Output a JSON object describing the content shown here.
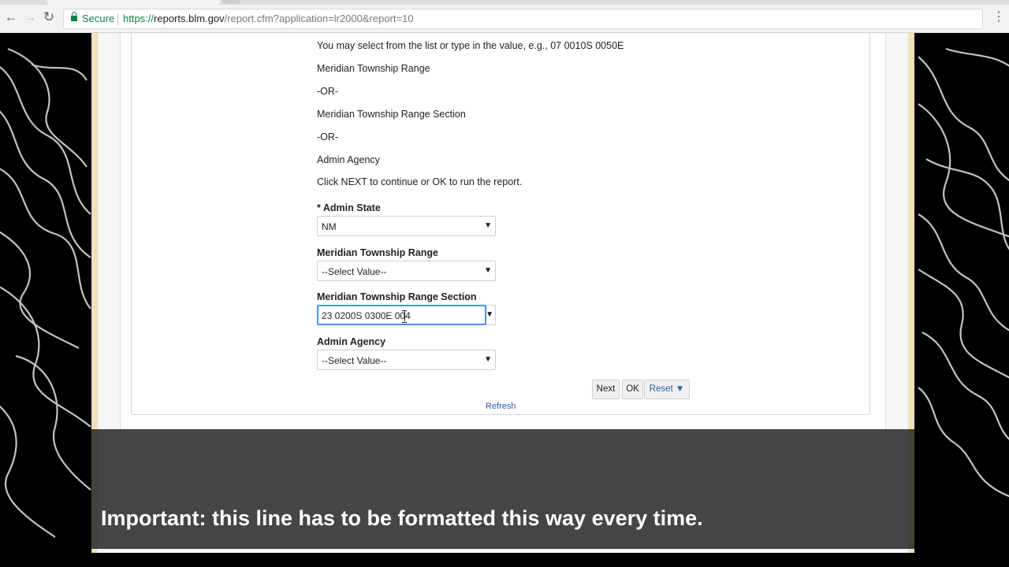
{
  "browser": {
    "secure_label": "Secure",
    "url_scheme": "https://",
    "url_host": "reports.blm.gov",
    "url_path": "/report.cfm?application=lr2000&report=10"
  },
  "instructions": {
    "line1": "You may select from the list or type in the value, e.g., 07 0010S 0050E",
    "line2": "Meridian Township Range",
    "line3": "-OR-",
    "line4": "Meridian Township Range Section",
    "line5": "-OR-",
    "line6": "Admin Agency",
    "line7": "Click NEXT to continue or OK to run the report."
  },
  "form": {
    "admin_state": {
      "label": "* Admin State",
      "value": "NM"
    },
    "mtr": {
      "label": "Meridian Township Range",
      "value": "--Select Value--"
    },
    "mtrs": {
      "label": "Meridian Township Range Section",
      "value": "23 0200S 0300E 004"
    },
    "admin_agency": {
      "label": "Admin Agency",
      "value": "--Select Value--"
    }
  },
  "buttons": {
    "next": "Next",
    "ok": "OK",
    "reset": "Reset ▼",
    "refresh": "Refresh"
  },
  "caption": "Important: this line has to be formatted this way every time.",
  "colors": {
    "secure_green": "#0b8043",
    "link_blue": "#2a5db0",
    "focus_blue": "#4d90fe",
    "frame_tan": "#f1e0bb"
  }
}
